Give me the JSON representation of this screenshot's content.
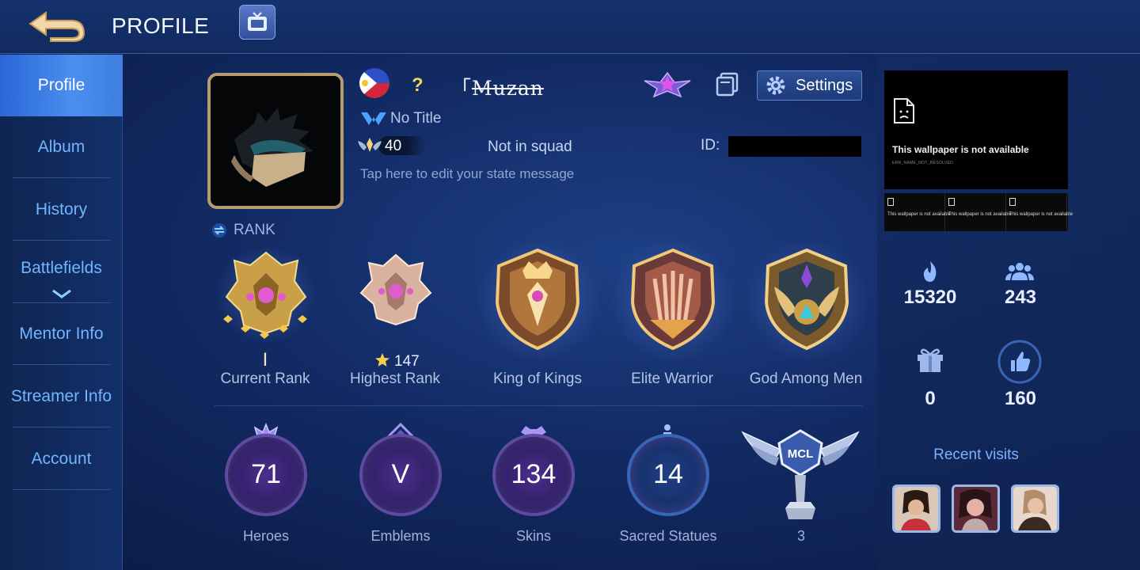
{
  "header": {
    "title": "PROFILE"
  },
  "sidebar": {
    "items": [
      {
        "label": "Profile"
      },
      {
        "label": "Album"
      },
      {
        "label": "History"
      },
      {
        "label": "Battlefields"
      },
      {
        "label": "Mentor Info"
      },
      {
        "label": "Streamer Info"
      },
      {
        "label": "Account"
      }
    ]
  },
  "profile": {
    "question_mark": "?",
    "username_prefix": "「",
    "username": "Muzan",
    "title": "No Title",
    "level": "40",
    "squad": "Not in squad",
    "id_label": "ID:",
    "state_message": "Tap here to edit your state message",
    "settings_label": "Settings",
    "rank_label": "RANK"
  },
  "badges": [
    {
      "label": "Current Rank",
      "sub": "I"
    },
    {
      "label": "Highest Rank",
      "sub": "147"
    },
    {
      "label": "King of Kings"
    },
    {
      "label": "Elite Warrior"
    },
    {
      "label": "God Among Men"
    }
  ],
  "stats": [
    {
      "value": "71",
      "label": "Heroes"
    },
    {
      "value": "V",
      "label": "Emblems"
    },
    {
      "value": "134",
      "label": "Skins"
    },
    {
      "value": "14",
      "label": "Sacred Statues"
    },
    {
      "value": "3",
      "label": "MCL"
    }
  ],
  "right": {
    "wallpaper_text": "This wallpaper is not available",
    "wallpaper_sub": "ERR_NAME_NOT_RESOLVED",
    "thumb_text": "This wallpaper is not available",
    "popularity": "15320",
    "friends": "243",
    "gifts": "0",
    "likes": "160",
    "recent_visits": "Recent visits"
  },
  "colors": {
    "accent_blue": "#6fb6ff",
    "active_tab": "#3e7fe0",
    "gold": "#e0b85a",
    "purple_ring": "#5d4aa1"
  }
}
